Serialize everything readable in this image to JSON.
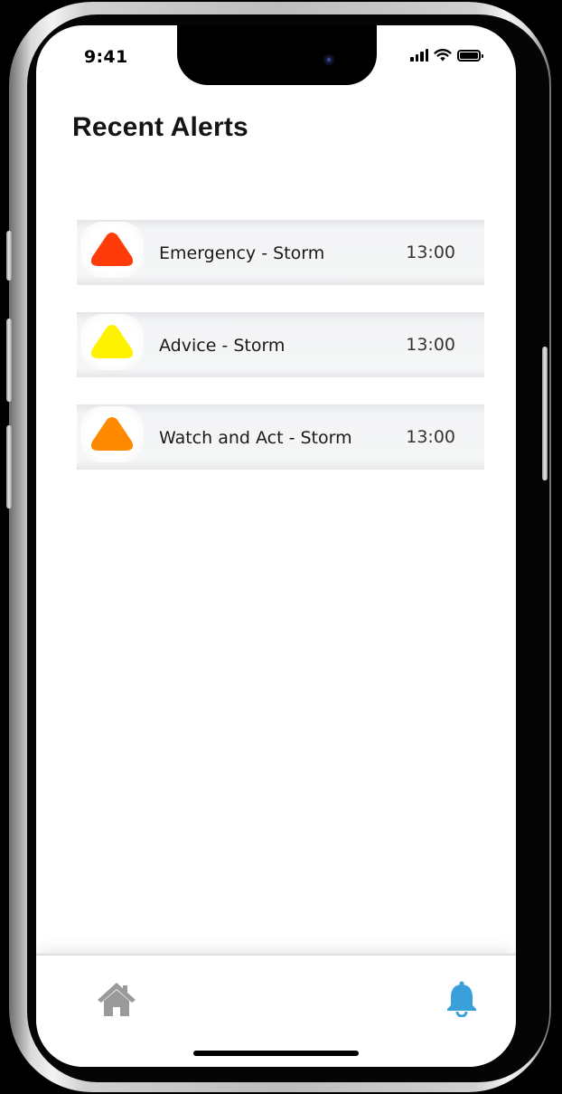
{
  "status_bar": {
    "time": "9:41",
    "icons": [
      "cellular-signal-icon",
      "wifi-icon",
      "battery-icon"
    ]
  },
  "page": {
    "title": "Recent Alerts"
  },
  "alerts": [
    {
      "label": "Emergency - Storm",
      "time": "13:00",
      "icon": "warning-triangle-icon",
      "color": "#ff3b0a"
    },
    {
      "label": "Advice - Storm",
      "time": "13:00",
      "icon": "warning-triangle-icon",
      "color": "#fff200"
    },
    {
      "label": "Watch and Act - Storm",
      "time": "13:00",
      "icon": "warning-triangle-icon",
      "color": "#ff8a00"
    }
  ],
  "tab_bar": {
    "items": [
      {
        "name": "home",
        "icon": "home-icon",
        "active": false,
        "color": "#9a9a9a"
      },
      {
        "name": "alerts",
        "icon": "bell-icon",
        "active": true,
        "color": "#3aa0dc"
      }
    ]
  },
  "colors": {
    "background": "#ffffff",
    "title": "#141414",
    "accent": "#3aa0dc",
    "inactive_icon": "#9a9a9a"
  }
}
